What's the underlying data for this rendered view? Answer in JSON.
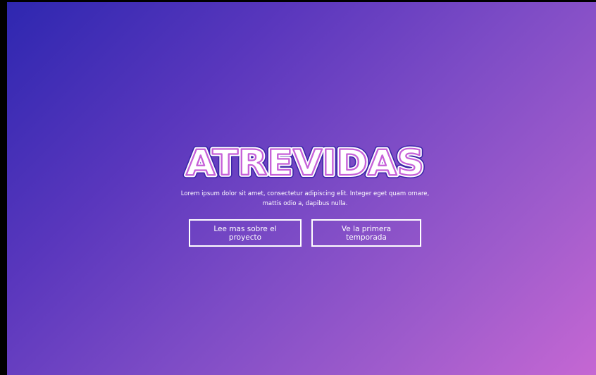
{
  "hero": {
    "title": "ATREVIDAS",
    "description": "Lorem ipsum dolor sit amet, consectetur adipiscing elit. Integer eget quam ornare, mattis odio a, dapibus nulla.",
    "buttons": [
      {
        "label": "Lee mas sobre el proyecto"
      },
      {
        "label": "Ve la primera temporada"
      }
    ]
  },
  "colors": {
    "gradient_start": "#2e27b0",
    "gradient_end": "#c567d3",
    "title_outline_outer": "#3b25a8",
    "title_outline_inner": "#c660d8",
    "text": "#ffffff"
  }
}
